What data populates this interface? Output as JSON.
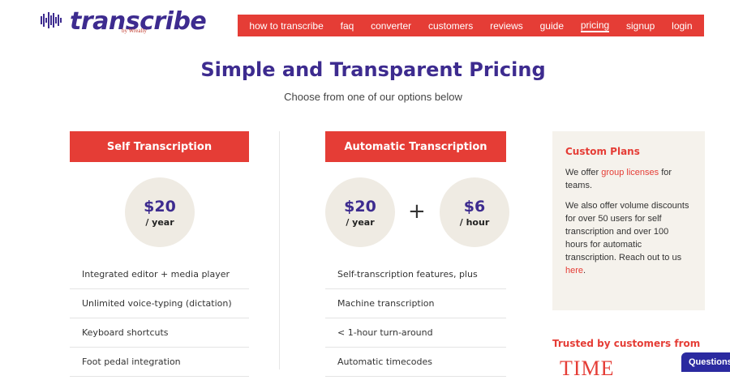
{
  "logo": {
    "name": "transcribe",
    "by": "by Wreally"
  },
  "nav": {
    "items": [
      "how to transcribe",
      "faq",
      "converter",
      "customers",
      "reviews",
      "guide",
      "pricing",
      "signup",
      "login"
    ],
    "active": "pricing",
    "color": "#e53d36"
  },
  "page": {
    "title": "Simple and Transparent Pricing",
    "subtitle": "Choose from one of our options below"
  },
  "self_plan": {
    "header": "Self Transcription",
    "price": "$20",
    "period": "/ year",
    "features": [
      "Integrated editor + media player",
      "Unlimited voice-typing (dictation)",
      "Keyboard shortcuts",
      "Foot pedal integration"
    ]
  },
  "auto_plan": {
    "header": "Automatic Transcription",
    "price1": "$20",
    "period1": "/ year",
    "plus": "+",
    "price2": "$6",
    "period2": "/ hour",
    "features": [
      "Self-transcription features, plus",
      "Machine transcription",
      "< 1-hour turn-around",
      "Automatic timecodes"
    ]
  },
  "custom": {
    "title": "Custom Plans",
    "p1_before": "We offer ",
    "p1_link": "group licenses",
    "p1_after": " for teams.",
    "p2_text": "We also offer volume discounts for over 50 users for self transcription and over 100 hours for automatic transcription. Reach out to us ",
    "p2_link": "here",
    "p2_after": "."
  },
  "trusted": {
    "heading": "Trusted by customers from",
    "logo_text": "TIME"
  },
  "chat": {
    "label": "Questions"
  },
  "colors": {
    "brand_purple": "#3d2b8f",
    "accent_red": "#e53d36",
    "circle_bg": "#efebe3",
    "panel_bg": "#f5f2ec"
  }
}
